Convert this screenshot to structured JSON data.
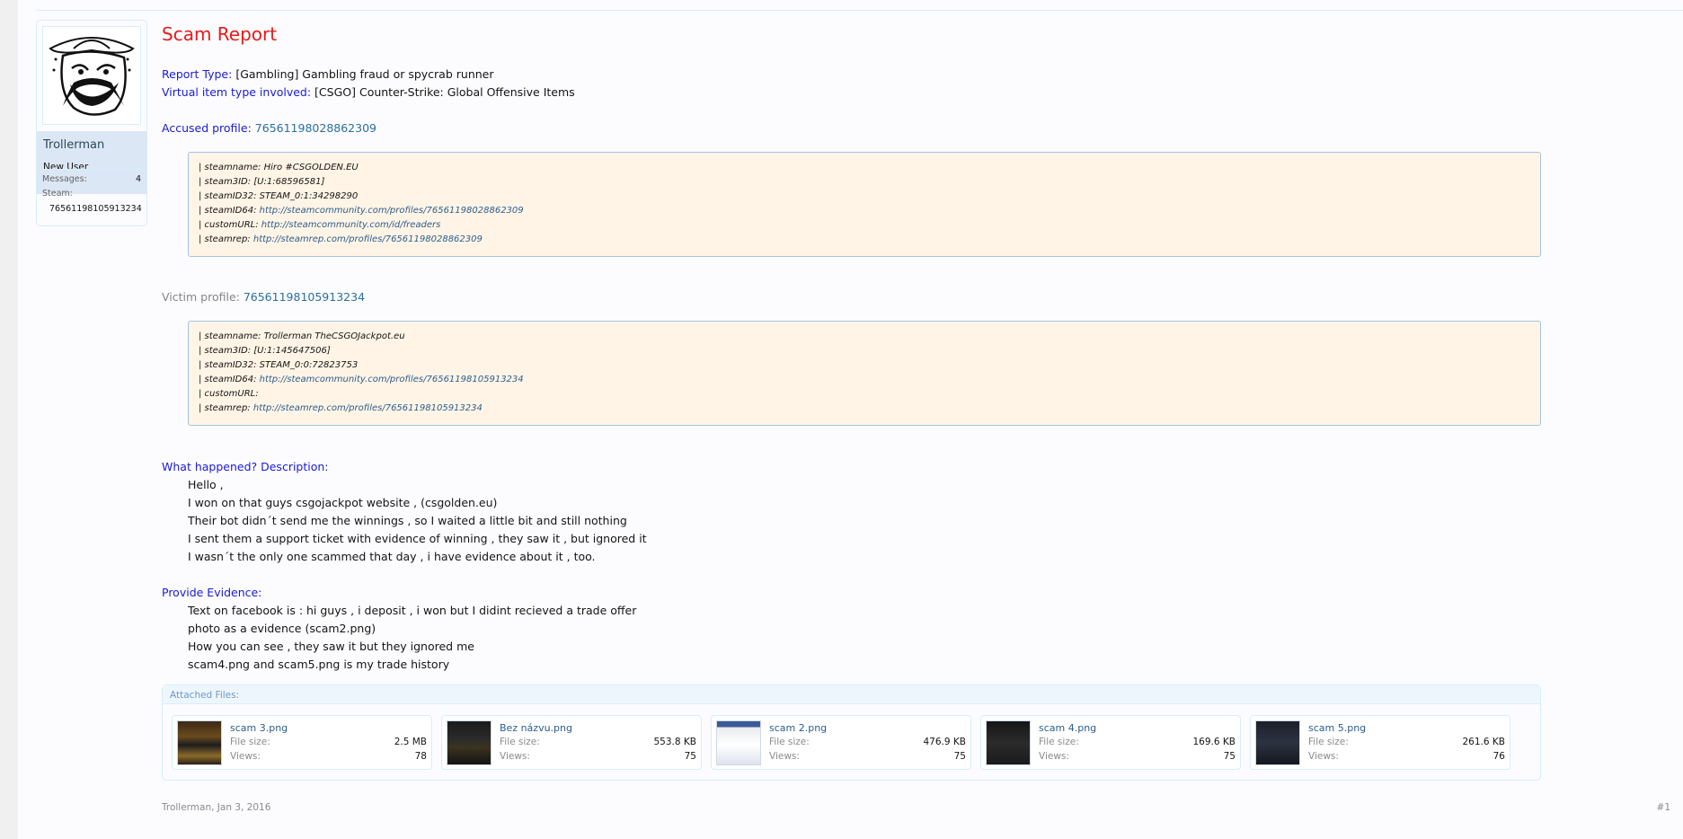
{
  "user": {
    "name": "Trollerman",
    "title": "New User",
    "messages_label": "Messages:",
    "messages_value": "4",
    "steam_label": "Steam:",
    "steam_value": "76561198105913234"
  },
  "post": {
    "title": "Scam Report",
    "report_type_label": "Report Type:",
    "report_type_value": " [Gambling] Gambling fraud or spycrab runner",
    "item_type_label": "Virtual item type involved:",
    "item_type_value": " [CSGO] Counter-Strike: Global Offensive Items",
    "accused_label": "Accused profile:",
    "accused_id": "76561198028862309",
    "accused_info": [
      {
        "text": "| steamname: Hiro #CSGOLDEN.EU",
        "link": ""
      },
      {
        "text": "| steam3ID: [U:1:68596581]",
        "link": ""
      },
      {
        "text": "| steamID32: STEAM_0:1:34298290",
        "link": ""
      },
      {
        "text": "| steamID64: ",
        "link": "http://steamcommunity.com/profiles/76561198028862309"
      },
      {
        "text": "| customURL: ",
        "link": "http://steamcommunity.com/id/freaders"
      },
      {
        "text": "| steamrep: ",
        "link": "http://steamrep.com/profiles/76561198028862309"
      }
    ],
    "victim_label": "Victim profile:",
    "victim_id": "76561198105913234",
    "victim_info": [
      {
        "text": "| steamname: Trollerman TheCSGOJackpot.eu",
        "link": ""
      },
      {
        "text": "| steam3ID: [U:1:145647506]",
        "link": ""
      },
      {
        "text": "| steamID32: STEAM_0:0:72823753",
        "link": ""
      },
      {
        "text": "| steamID64: ",
        "link": "http://steamcommunity.com/profiles/76561198105913234"
      },
      {
        "text": "| customURL:",
        "link": ""
      },
      {
        "text": "| steamrep: ",
        "link": "http://steamrep.com/profiles/76561198105913234"
      }
    ],
    "description_label": "What happened? Description:",
    "description": [
      "Hello ,",
      "I won on that guys csgojackpot website , (csgolden.eu)",
      "Their bot didn´t send me the winnings , so I waited a little bit and still nothing",
      "I sent them a support ticket with evidence of winning , they saw it , but ignored it",
      "I wasn´t the only one scammed that day , i have evidence about it , too."
    ],
    "evidence_label": "Provide Evidence:",
    "evidence": [
      "Text on facebook is : hi guys , i deposit , i won but I didint recieved a trade offer",
      "photo as a evidence (scam2.png)",
      "How you can see , they saw it but they ignored me",
      "scam4.png and scam5.png is my trade history"
    ],
    "attachments_header": "Attached Files:",
    "size_label": "File size:",
    "views_label": "Views:",
    "attachments": [
      {
        "name": "scam 3.png",
        "size": "2.5 MB",
        "views": "78"
      },
      {
        "name": "Bez názvu.png",
        "size": "553.8 KB",
        "views": "75"
      },
      {
        "name": "scam 2.png",
        "size": "476.9 KB",
        "views": "75"
      },
      {
        "name": "scam 4.png",
        "size": "169.6 KB",
        "views": "75"
      },
      {
        "name": "scam 5.png",
        "size": "261.6 KB",
        "views": "76"
      }
    ],
    "author": "Trollerman",
    "date": "Jan 3, 2016",
    "author_date": "Trollerman, Jan 3, 2016",
    "post_number": "#1"
  }
}
